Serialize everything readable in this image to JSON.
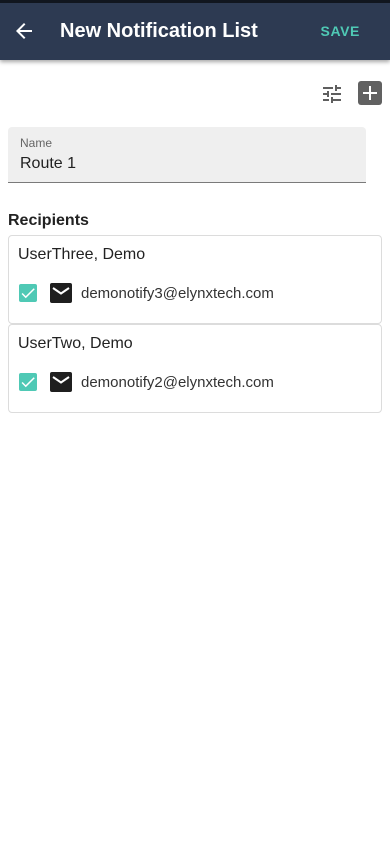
{
  "header": {
    "title": "New Notification List",
    "save_label": "SAVE"
  },
  "toolbar": {
    "filter_icon": "tune-icon",
    "add_icon": "add-box-icon"
  },
  "name_field": {
    "label": "Name",
    "value": "Route 1"
  },
  "recipients": {
    "title": "Recipients",
    "items": [
      {
        "name": "UserThree, Demo",
        "email": "demonotify3@elynxtech.com",
        "checked": true
      },
      {
        "name": "UserTwo, Demo",
        "email": "demonotify2@elynxtech.com",
        "checked": true
      }
    ]
  },
  "colors": {
    "appbar": "#2d3a52",
    "accent": "#4fc9b5"
  }
}
